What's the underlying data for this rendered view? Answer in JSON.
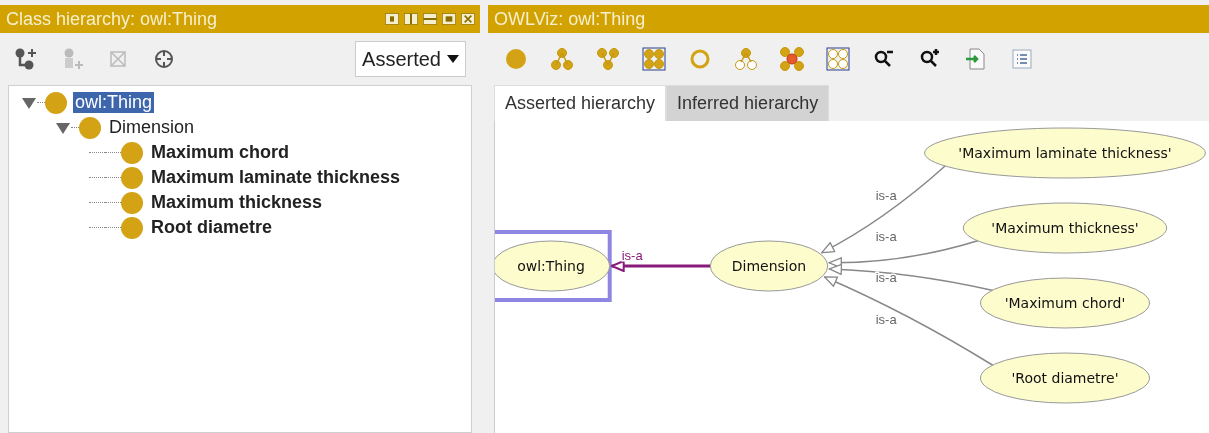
{
  "class_hierarchy": {
    "title": "Class hierarchy: owl:Thing",
    "mode_dropdown": {
      "value": "Asserted"
    },
    "tree": [
      {
        "label": "owl:Thing",
        "selected": true,
        "expanded": true,
        "bold": false,
        "children": [
          {
            "label": "Dimension",
            "selected": false,
            "expanded": true,
            "bold": false,
            "children": [
              {
                "label": "Maximum chord",
                "selected": false,
                "bold": true
              },
              {
                "label": "Maximum laminate thickness",
                "selected": false,
                "bold": true
              },
              {
                "label": "Maximum thickness",
                "selected": false,
                "bold": true
              },
              {
                "label": "Root diametre",
                "selected": false,
                "bold": true
              }
            ]
          }
        ]
      }
    ]
  },
  "owlviz": {
    "title": "OWLViz: owl:Thing",
    "tabs": [
      {
        "label": "Asserted hierarchy",
        "selected": true
      },
      {
        "label": "Inferred hierarchy",
        "selected": false
      }
    ],
    "graph": {
      "root": {
        "label": "owl:Thing",
        "selected": true,
        "children": [
          {
            "label": "Dimension",
            "selected": false,
            "edge_label": "is-a",
            "children": [
              {
                "label": "'Maximum laminate thickness'",
                "selected": false,
                "edge_label": "is-a"
              },
              {
                "label": "'Maximum thickness'",
                "selected": false,
                "edge_label": "is-a"
              },
              {
                "label": "'Maximum chord'",
                "selected": false,
                "edge_label": "is-a"
              },
              {
                "label": "'Root diametre'",
                "selected": false,
                "edge_label": "is-a"
              }
            ]
          }
        ]
      }
    }
  }
}
